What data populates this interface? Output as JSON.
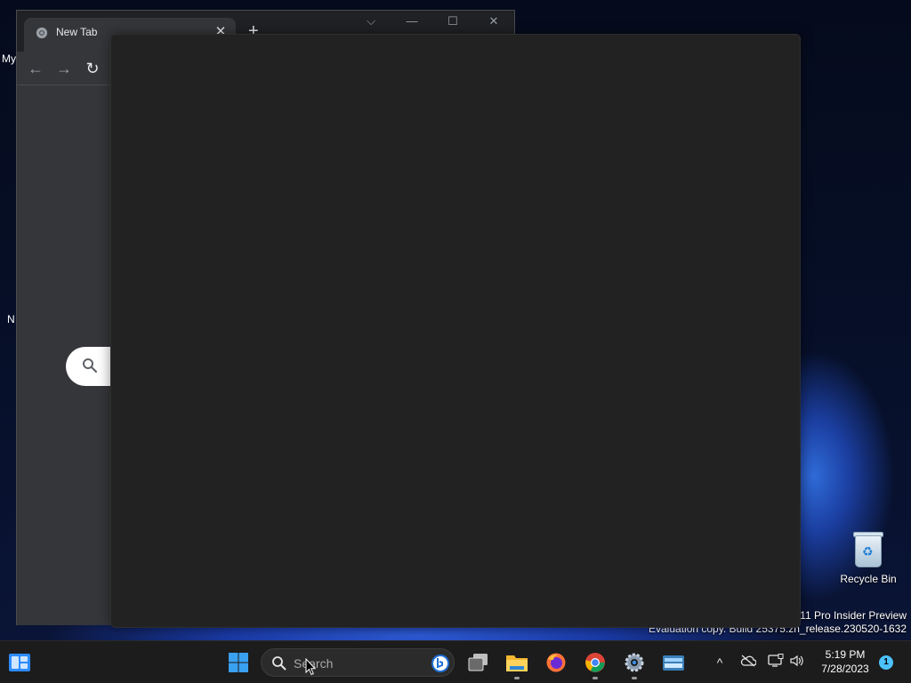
{
  "desktop": {
    "left_label": "My",
    "left_label_n": "N",
    "recycle_bin_label": "Recycle Bin",
    "watermark_line1": "s 11 Pro Insider Preview",
    "watermark_line2": "Evaluation copy. Build 25375.zn_release.230520-1632"
  },
  "chrome": {
    "tab_title": "New Tab",
    "tab_close": "✕",
    "new_tab": "+",
    "win_controls": {
      "dropdown": "⌵",
      "minimize": "—",
      "maximize": "☐",
      "close": "✕"
    },
    "nav": {
      "back": "←",
      "forward": "→",
      "reload": "↻"
    }
  },
  "taskbar": {
    "search_placeholder": "Search",
    "tray_chevron": "^",
    "clock_time": "5:19 PM",
    "clock_date": "7/28/2023",
    "notification_count": "1"
  },
  "colors": {
    "taskbar_bg": "#1c1c1c",
    "overlay_bg": "#222222",
    "chrome_frame": "#202124",
    "chrome_surface": "#35363a",
    "accent_blue": "#4cc2ff"
  }
}
